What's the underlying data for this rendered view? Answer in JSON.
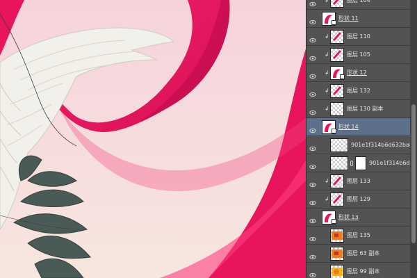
{
  "canvas": {
    "colors": {
      "background_top": "#f6d3dc",
      "background_bottom": "#f6e6de",
      "ribbon": "#e8155e",
      "ribbon_shadow": "#b90a48",
      "feather": "#f1f0eb",
      "leaf": "#4a5a56"
    }
  },
  "layers_panel": {
    "selected_index": 7,
    "layers": [
      {
        "name": "图层 104",
        "kind": "layer",
        "clipped": true,
        "thumb": "red-stroke"
      },
      {
        "name": "形状 11",
        "kind": "shape",
        "clipped": false,
        "thumb": "red-curve"
      },
      {
        "name": "图层 110",
        "kind": "layer",
        "clipped": true,
        "thumb": "red-stroke"
      },
      {
        "name": "图层 105",
        "kind": "layer",
        "clipped": true,
        "thumb": "red-stroke"
      },
      {
        "name": "形状 12",
        "kind": "shape",
        "clipped": true,
        "thumb": "red-curve"
      },
      {
        "name": "图层 132",
        "kind": "layer",
        "clipped": true,
        "thumb": "red-stroke"
      },
      {
        "name": "图层 130 副本",
        "kind": "layer",
        "clipped": true,
        "thumb": "checker"
      },
      {
        "name": "形状 14",
        "kind": "shape",
        "clipped": false,
        "thumb": "red-curve"
      },
      {
        "name": "901e1f314b6d632ba84d...",
        "kind": "layer",
        "clipped": false,
        "thumb": "checker-wide"
      },
      {
        "name": "901e1f314b6d63...",
        "kind": "masked",
        "clipped": false,
        "thumb": "checker-wide"
      },
      {
        "name": "图层 133",
        "kind": "layer",
        "clipped": true,
        "thumb": "red-stroke"
      },
      {
        "name": "图层 129",
        "kind": "layer",
        "clipped": true,
        "thumb": "red-stroke"
      },
      {
        "name": "形状 13",
        "kind": "shape",
        "clipped": false,
        "thumb": "red-curve"
      },
      {
        "name": "图层 135",
        "kind": "layer",
        "clipped": false,
        "thumb": "orange"
      },
      {
        "name": "图层 63 副本",
        "kind": "layer",
        "clipped": false,
        "thumb": "orange"
      },
      {
        "name": "图层 99 副本",
        "kind": "layer",
        "clipped": false,
        "thumb": "orange-yellow"
      }
    ]
  }
}
